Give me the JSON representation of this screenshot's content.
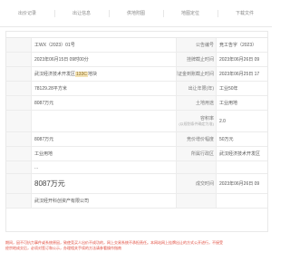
{
  "tabs": [
    "出价记录",
    "出让信息",
    "供地附图",
    "地图定位",
    "下载文件"
  ],
  "rows": [
    {
      "v1": "工WX（2023）01号",
      "label": "公告编号",
      "v2": "竞工告字（2023）"
    },
    {
      "v1": "2023年06月15日 09时00分",
      "label": "挂牌截止时间",
      "v2": "2023年06月26日 09"
    },
    {
      "v1_pre": "武汉经济技术开发区",
      "v1_hl": "133C",
      "v1_post": "地块",
      "label": "保证金到账截止时间",
      "v2": "2023年06月25日 17"
    },
    {
      "v1": "78129.28平方米",
      "label": "出让年限(年)",
      "v2": "工业50年"
    },
    {
      "v1": "8087万元",
      "label": "土地用途",
      "v2": "工业用地"
    },
    {
      "v1": "",
      "label": "容积率",
      "sub": "(以规划条件确定为准)",
      "v2": "2.0"
    },
    {
      "v1": "8087万元",
      "label": "竞价增价幅度",
      "v2": "50万元"
    },
    {
      "v1": "工业用地",
      "label": "所属行政区",
      "v2": "武汉经济技术开发区"
    },
    {
      "v1": "...",
      "label": "",
      "v2": ""
    },
    {
      "v1": "8087万元",
      "label": "成交时间",
      "v2": "2023年06月26日 09"
    },
    {
      "v1": "武汉经开科创资产有限公司",
      "label": "",
      "v2": ""
    }
  ],
  "notice": {
    "line1": "期间，因不可抗力事件或系统原因，致使竞买人出价不成功的，网上交易系统不承担责任。本网站网上挂牌出让的方式公开进行，不接受",
    "line2": "经宗地成交后，必须对签订和公示，办理相关手续的方法请参看",
    "link": "操作指南"
  },
  "colors": {
    "notice": "#e04a3c",
    "highlight": "#f4e3b4",
    "label_bg": "#f7f7f7"
  }
}
